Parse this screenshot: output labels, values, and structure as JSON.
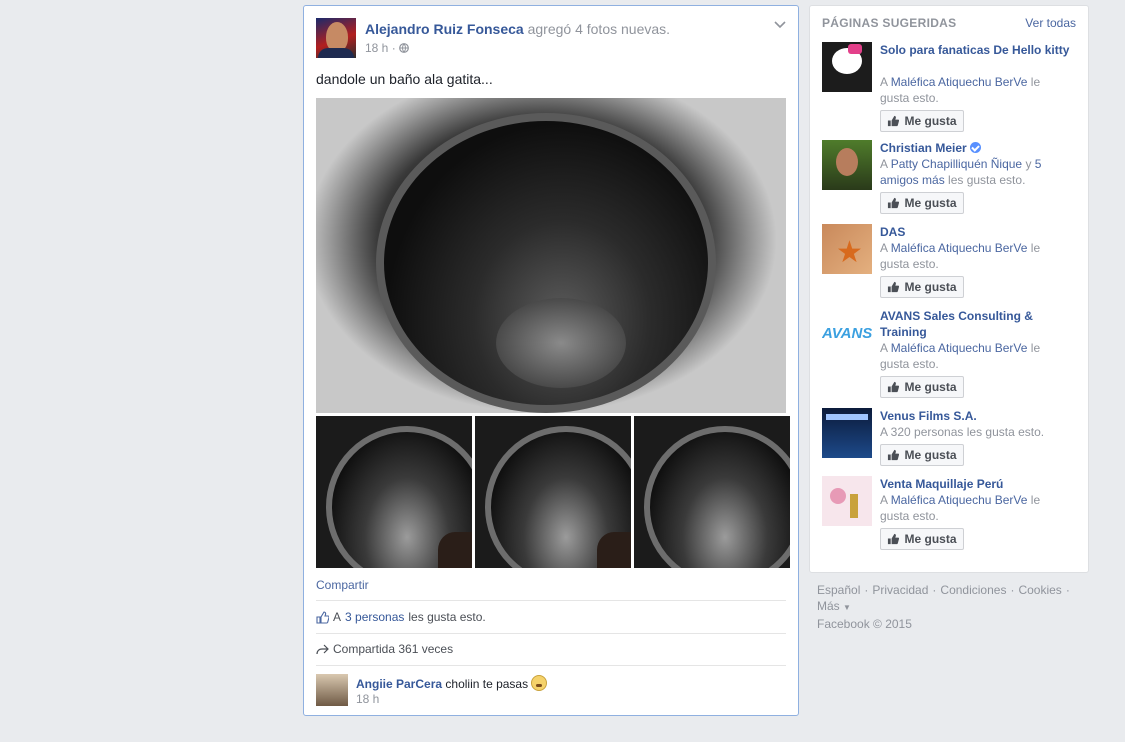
{
  "post": {
    "author": "Alejandro Ruiz Fonseca",
    "action": "agregó 4 fotos nuevas.",
    "time": "18 h",
    "separator": "·",
    "privacy_icon": "globe-icon",
    "menu_icon": "chevron-down-icon",
    "text": "dandole un baño ala gatita...",
    "share_label": "Compartir",
    "likes": {
      "prefix": "A ",
      "count_link": "3 personas",
      "suffix": " les gusta esto."
    },
    "shares": {
      "text": "Compartida 361 veces"
    },
    "comment": {
      "author": "Angiie ParCera",
      "text": "choliin te pasas",
      "time": "18 h"
    }
  },
  "sidebar": {
    "title": "PÁGINAS SUGERIDAS",
    "see_all": "Ver todas",
    "like_label": "Me gusta",
    "items": [
      {
        "name": "Solo para fanaticas De Hello kitty",
        "desc_prefix": "A ",
        "desc_link": "Maléfica Atiquechu BerVe",
        "desc_suffix": " le gusta esto."
      },
      {
        "name": "Christian Meier",
        "desc_prefix": "A ",
        "desc_link": "Patty Chapilliquén Ñique",
        "desc_mid": " y ",
        "desc_link2": "5 amigos más",
        "desc_suffix": " les gusta esto."
      },
      {
        "name": "DAS",
        "desc_prefix": "A ",
        "desc_link": "Maléfica Atiquechu BerVe",
        "desc_suffix": " le gusta esto."
      },
      {
        "name": "AVANS Sales Consulting & Training",
        "desc_prefix": "A ",
        "desc_link": "Maléfica Atiquechu BerVe",
        "desc_suffix": " le gusta esto."
      },
      {
        "name": "Venus Films S.A.",
        "desc_prefix": "",
        "desc_link": "",
        "desc_suffix": "A 320 personas les gusta esto."
      },
      {
        "name": "Venta Maquillaje Perú",
        "desc_prefix": "A ",
        "desc_link": "Maléfica Atiquechu BerVe",
        "desc_suffix": " le gusta esto."
      }
    ],
    "pic_labels": {
      "avans": "AVANS"
    }
  },
  "footer": {
    "links": [
      "Español",
      "Privacidad",
      "Condiciones",
      "Cookies",
      "Más"
    ],
    "copyright": "Facebook © 2015"
  },
  "colors": {
    "link": "#365899",
    "meta": "#90949c",
    "accent_border": "#8fb0e0",
    "background": "#e9ebee"
  }
}
